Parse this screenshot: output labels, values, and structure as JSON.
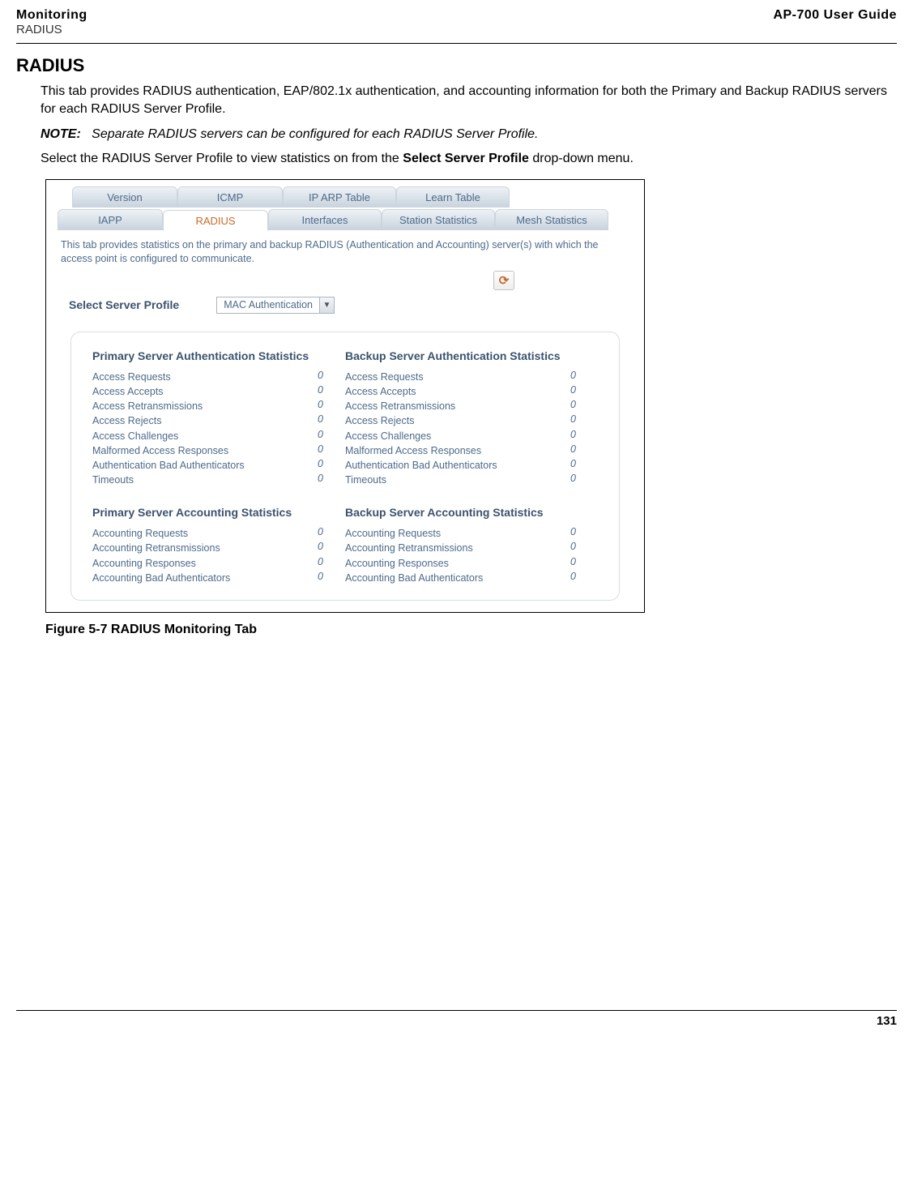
{
  "header": {
    "left1": "Monitoring",
    "left2": "RADIUS",
    "right": "AP-700 User Guide"
  },
  "section_title": "RADIUS",
  "para1": "This tab provides RADIUS authentication, EAP/802.1x authentication, and accounting information for both the Primary and Backup RADIUS servers for each RADIUS Server Profile.",
  "note": {
    "label": "NOTE:",
    "text": "Separate RADIUS servers can be configured for each RADIUS Server Profile."
  },
  "para2_a": "Select the RADIUS Server Profile to view statistics on from the ",
  "para2_b": "Select Server Profile",
  "para2_c": " drop-down menu.",
  "screenshot": {
    "tabs_row1": [
      "Version",
      "ICMP",
      "IP ARP Table",
      "Learn Table"
    ],
    "tabs_row2": [
      "IAPP",
      "RADIUS",
      "Interfaces",
      "Station Statistics",
      "Mesh Statistics"
    ],
    "active_tab_index": 1,
    "desc": "This tab provides statistics on the primary and backup RADIUS (Authentication and Accounting) server(s) with which the access point is configured to communicate.",
    "profile_label": "Select Server Profile",
    "profile_value": "MAC Authentication",
    "refresh_glyph": "⟳",
    "headings": {
      "primary_auth": "Primary Server Authentication Statistics",
      "backup_auth": "Backup Server Authentication Statistics",
      "primary_acct": "Primary Server Accounting Statistics",
      "backup_acct": "Backup Server Accounting Statistics"
    },
    "auth_rows": [
      "Access Requests",
      "Access Accepts",
      "Access Retransmissions",
      "Access Rejects",
      "Access Challenges",
      "Malformed Access Responses",
      "Authentication Bad Authenticators",
      "Timeouts"
    ],
    "acct_rows": [
      "Accounting Requests",
      "Accounting Retransmissions",
      "Accounting Responses",
      "Accounting Bad Authenticators"
    ],
    "zero": "0"
  },
  "fig_caption": "Figure 5-7 RADIUS Monitoring Tab",
  "page_number": "131"
}
